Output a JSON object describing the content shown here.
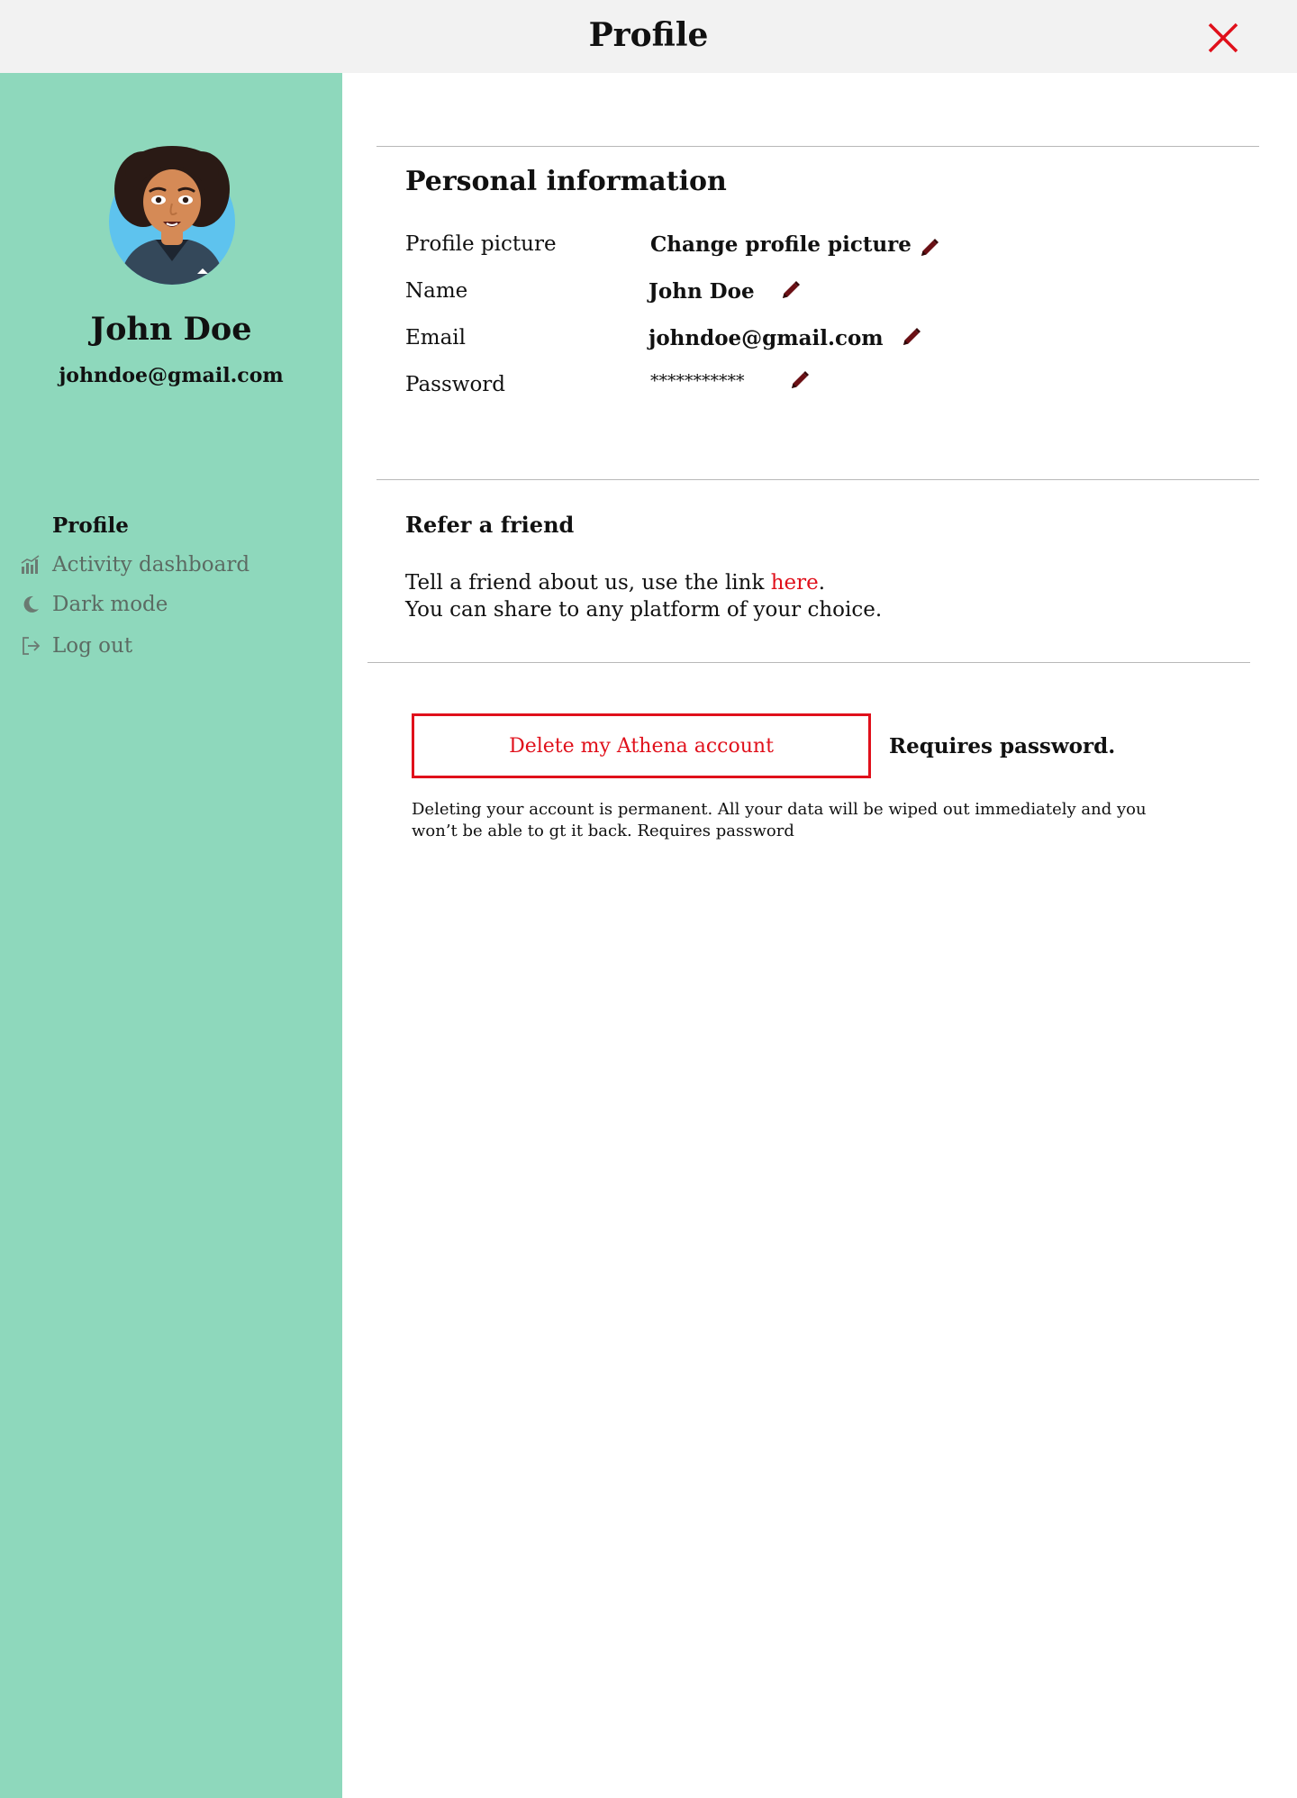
{
  "header": {
    "title": "Profile",
    "close_icon": "close-x-icon",
    "close_color": "#e0101b"
  },
  "sidebar": {
    "background": "#8ed8bc",
    "avatar_icon": "user-avatar",
    "name": "John Doe",
    "email": "johndoe@gmail.com",
    "items": [
      {
        "label": "Profile",
        "icon": "",
        "active": true
      },
      {
        "label": "Activity dashboard",
        "icon": "bar-chart-icon",
        "active": false
      },
      {
        "label": "Dark mode",
        "icon": "moon-icon",
        "active": false
      },
      {
        "label": "Log out",
        "icon": "logout-icon",
        "active": false
      }
    ]
  },
  "personal_info": {
    "title": "Personal information",
    "rows": [
      {
        "label": "Profile picture",
        "value": "Change profile picture",
        "edit_icon": "pencil-icon"
      },
      {
        "label": "Name",
        "value": "John Doe",
        "edit_icon": "pencil-icon"
      },
      {
        "label": "Email",
        "value": "johndoe@gmail.com",
        "edit_icon": "pencil-icon"
      },
      {
        "label": "Password",
        "value": "***********",
        "edit_icon": "pencil-icon"
      }
    ]
  },
  "refer": {
    "title": "Refer a friend",
    "line1_prefix": "Tell a friend about us, use the link ",
    "link_text": "here",
    "line1_suffix": ".",
    "line2": "You can share to any platform of your choice.",
    "link_color": "#e0101b"
  },
  "delete": {
    "button_label": "Delete my Athena account",
    "requires": "Requires password.",
    "warning": "Deleting  your account is permanent. All your data will be wiped out immediately and you won’t be able to gt it back. Requires password",
    "accent": "#e0101b"
  }
}
